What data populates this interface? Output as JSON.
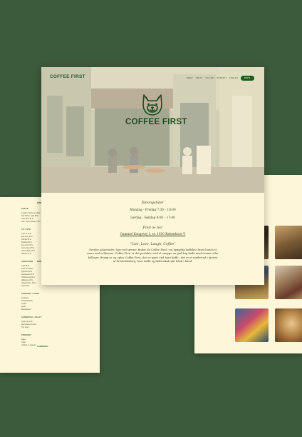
{
  "main": {
    "brand": "COFFEE FIRST",
    "nav": [
      "MENU",
      "OM OS",
      "GALLERI",
      "KONTAKT",
      "FIND OS"
    ],
    "nav_cta": "BESTIL",
    "logo_text": "COFFEE FIRST",
    "hours_heading": "Åbningstider",
    "hours_weekday": "Mandag - Fredag 7:30 – 18:00",
    "hours_weekend": "Lørdag - Søndag 9:00 – 17:00",
    "find_heading": "Find os her",
    "address": "Gammel Kongevej 1, st. 1610 København V",
    "tagline": "“Live, Love, Laugh, Coffee”",
    "description": "Overfor planetariet, lige ved søerne, finder du Coffee First - en hyggelig kaffebar bryst hundo vi mere end velkomne. Coffee First er det perfekte sted at snuppe en god kop kaffe med venner eller kolleger. Besøg os og oplev Coffee First, der er mere end bare kaffe - det er et mødested i hjertet af Frederiksberg, hvor kaffe og fællesskab går hånd i hånd."
  },
  "back_left": {
    "sections": [
      {
        "heading": "KAFFE",
        "lines": [
          "Cortado / Espresso  28 kr",
          "Flat White / Latte  38 kr",
          "Chai Latte  42 kr",
          "Oat / Soja / Mandel +5 kr"
        ]
      },
      {
        "heading": "TE / ISTE",
        "lines": [
          "Grøn te  30 kr",
          "Earl Grey  30 kr",
          "Kamille  30 kr",
          "Rooibos  30 kr",
          "Iste citron  35 kr",
          "Iste fersken  35 kr",
          "Iste hindbær  35 kr",
          "Matcha  40 kr"
        ]
      },
      {
        "heading": "SODAVAND",
        "lines": [
          "Cola  28 kr",
          "Cola zero  28 kr",
          "Appelsin  28 kr",
          "Danskvand  25 kr",
          "Hindbærsaft  28 kr",
          "Æblejuice  28 kr",
          "Appelsinjuice  30 kr",
          "Vand  15 kr"
        ]
      },
      {
        "heading": "FROKOST / KAGE",
        "lines": [
          "Croissant",
          "Chokoladebolle",
          "Cookie",
          "Muffin",
          "Bananabrød"
        ]
      },
      {
        "heading": "SANDWICH / SALAT",
        "lines": [
          "Kylling & pesto",
          "Mozzarella & tomat",
          "Tun & æg"
        ]
      },
      {
        "heading": "FROKOST",
        "lines": [
          "Bagel",
          "Toast",
          "Yoghurt m. granola"
        ]
      }
    ],
    "center_label_top": "SØDT",
    "center_label_mid": "DRIKKE",
    "center_label_bottom": "SANDWICH"
  }
}
